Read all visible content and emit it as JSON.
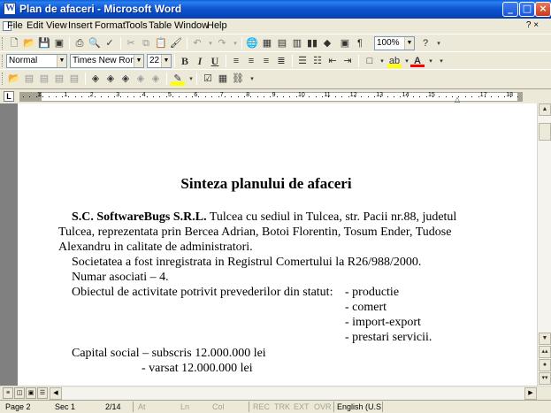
{
  "window": {
    "title": "Plan de afaceri - Microsoft Word",
    "controls": {
      "minimize": "_",
      "maximize": "□",
      "close": "×"
    }
  },
  "menu": {
    "items": [
      "File",
      "Edit",
      "View",
      "Insert",
      "Format",
      "Tools",
      "Table",
      "Window",
      "Help"
    ],
    "help_box": "? ×"
  },
  "standard_toolbar": {
    "zoom": "100%",
    "help": "?"
  },
  "formatting_toolbar": {
    "style": "Normal",
    "font": "Times New Roman",
    "size": "22",
    "bold": "B",
    "italic": "I",
    "underline": "U",
    "highlight": "ab",
    "font_color": "A"
  },
  "ruler": {
    "tab_selector": "L",
    "numbers": [
      "1",
      "2",
      "3",
      "4",
      "5",
      "6",
      "7",
      "8",
      "9",
      "10",
      "11",
      "12",
      "13",
      "14",
      "15",
      "17",
      "18"
    ]
  },
  "document": {
    "title": "Sinteza planului de afaceri",
    "company": "S.C. SoftwareBugs S.R.L.",
    "line1_rest": " Tulcea cu sediul in Tulcea, str. Pacii nr.88, judetul",
    "line2": "Tulcea, reprezentata prin Bercea Adrian, Botoi Florentin, Tosum Ender, Tudose",
    "line3": "Alexandru in calitate de administratori.",
    "line4": "Societatea a fost inregistrata in Registrul Comertului la R26/988/2000.",
    "line5": "Numar asociati – 4.",
    "line6": "Obiectul de activitate potrivit prevederilor din statut:",
    "activities": [
      "- productie",
      "- comert",
      "- import-export",
      "- prestari servicii."
    ],
    "line_capital": "Capital social – subscris 12.000.000 lei",
    "line_varsat": "-    varsat 12.000.000 lei"
  },
  "statusbar": {
    "page": "Page  2",
    "sec": "Sec  1",
    "pages": "2/14",
    "at": "At",
    "ln": "Ln",
    "col": "Col",
    "rec": "REC",
    "trk": "TRK",
    "ext": "EXT",
    "ovr": "OVR",
    "language": "English (U.S"
  }
}
